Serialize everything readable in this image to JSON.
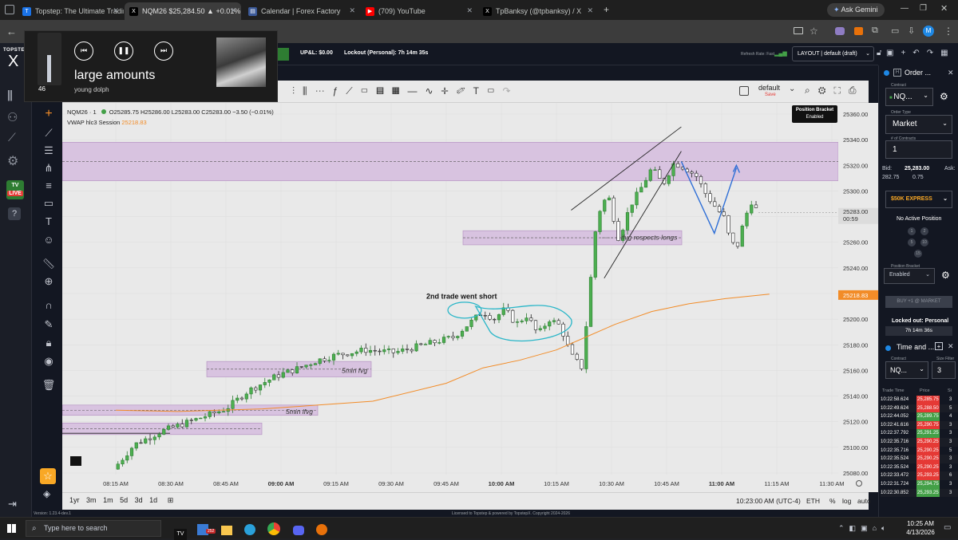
{
  "browser": {
    "tabs": [
      {
        "label": "Topstep: The Ultimate Trading E",
        "color": "#1a73e8",
        "glyph": "T"
      },
      {
        "label": "NQM26 $25,284.50 ▲ +0.01%",
        "color": "#000000",
        "glyph": "X"
      },
      {
        "label": "Calendar | Forex Factory",
        "color": "#3b5998",
        "glyph": "▤"
      },
      {
        "label": "(709) YouTube",
        "color": "#ff0000",
        "glyph": "▶"
      },
      {
        "label": "TpBanksy (@tpbanksy) / X",
        "color": "#000000",
        "glyph": "X"
      }
    ],
    "ask_gemini": "Ask Gemini",
    "profile_initial": "M"
  },
  "media": {
    "title": "large amounts",
    "artist": "young dolph"
  },
  "topbar": {
    "logo": "TOPSTEP",
    "logo_mark": "X",
    "count": "46",
    "upl": "UP&L: $0.00",
    "lockout": "Lockout (Personal): 7h 14m 35s",
    "refresh": "Refresh Rate: Fast",
    "layout": "LAYOUT | default (draft)"
  },
  "chart_toolbar": {
    "layout_name": "default",
    "save": "Save",
    "position_bracket": "Position Bracket",
    "position_bracket_status": "Enabled"
  },
  "legend": {
    "symbol": "NQM26 · 1",
    "ohlc": "O25285.75  H25286.00  L25283.00  C25283.00  −3.50 (−0.01%)",
    "vwap_label": "VWAP hlc3 Session",
    "vwap_value": "25218.83"
  },
  "price_axis": {
    "ticks": [
      "25360.00",
      "25340.00",
      "25320.00",
      "25300.00",
      "25280.00",
      "25260.00",
      "25240.00",
      "25220.00",
      "25200.00",
      "25180.00",
      "25160.00",
      "25140.00",
      "25120.00",
      "25100.00",
      "25080.00"
    ],
    "last_price": "25283.00",
    "countdown": "00:59",
    "vwap_tag": "25218.83"
  },
  "time_axis": {
    "ticks": [
      "08:15 AM",
      "08:30 AM",
      "08:45 AM",
      "09:00 AM",
      "09:15 AM",
      "09:30 AM",
      "09:45 AM",
      "10:00 AM",
      "10:15 AM",
      "10:30 AM",
      "10:45 AM",
      "11:00 AM",
      "11:15 AM",
      "11:30 AM"
    ]
  },
  "annotations": {
    "ifvg": "ifvg respects longs",
    "short": "2nd trade went short",
    "fvg5": "5min fvg",
    "ifvg5": "5min ifvg"
  },
  "bottom_bar": {
    "ranges": [
      "1yr",
      "3m",
      "1m",
      "5d",
      "3d",
      "1d"
    ],
    "clock": "10:23:00 AM (UTC-4)",
    "session": "ETH",
    "pct": "%",
    "log": "log",
    "auto": "auto"
  },
  "footer": {
    "version": "Version: 1.23.4-dev.1",
    "license": "Licensed to Topstep & powered by TopstepX. Copyright 2024-2026"
  },
  "order_panel": {
    "title": "Order ...",
    "contract_label": "Contract",
    "contract": "NQ...",
    "order_type_label": "Order Type",
    "order_type": "Market",
    "contracts_label": "# of Contracts",
    "contracts": "1",
    "bid_label": "Bid:",
    "bid": "282.75",
    "mid": "25,283.00",
    "spread": "0.75",
    "ask_label": "Ask:",
    "account": "$50K EXPRESS",
    "no_position": "No Active Position",
    "qty_buttons": [
      "1",
      "2",
      "5",
      "10",
      "15"
    ],
    "pb_label": "Position Bracket",
    "pb_value": "Enabled",
    "buy_button": "BUY +1 @ MARKET",
    "locked": "Locked out: Personal",
    "locked_time": "7h 14m 36s"
  },
  "time_sales": {
    "title": "Time and ...",
    "contract_label": "Contract",
    "contract": "NQ...",
    "size_label": "Size Filter",
    "size": "3",
    "headers": [
      "Trade Time",
      "Price",
      "Si"
    ],
    "rows": [
      {
        "time": "10:22:58.624",
        "price": "25,285.75",
        "size": "3",
        "side": "sell"
      },
      {
        "time": "10:22:49.624",
        "price": "25,288.50",
        "size": "5",
        "side": "sell"
      },
      {
        "time": "10:22:44.052",
        "price": "25,289.75",
        "size": "4",
        "side": "buy"
      },
      {
        "time": "10:22:41.616",
        "price": "25,290.75",
        "size": "3",
        "side": "sell"
      },
      {
        "time": "10:22:37.792",
        "price": "25,291.25",
        "size": "3",
        "side": "buy"
      },
      {
        "time": "10:22:35.716",
        "price": "25,290.25",
        "size": "3",
        "side": "sell"
      },
      {
        "time": "10:22:35.716",
        "price": "25,290.25",
        "size": "5",
        "side": "sell"
      },
      {
        "time": "10:22:35.524",
        "price": "25,290.25",
        "size": "3",
        "side": "sell"
      },
      {
        "time": "10:22:35.524",
        "price": "25,290.25",
        "size": "3",
        "side": "sell"
      },
      {
        "time": "10:22:33.472",
        "price": "25,293.25",
        "size": "6",
        "side": "sell"
      },
      {
        "time": "10:22:31.724",
        "price": "25,294.75",
        "size": "3",
        "side": "buy"
      },
      {
        "time": "10:22:30.852",
        "price": "25,293.25",
        "size": "3",
        "side": "buy"
      }
    ]
  },
  "taskbar": {
    "search_placeholder": "Type here to search",
    "time": "10:25 AM",
    "date": "4/13/2026",
    "badge": "252"
  },
  "colors": {
    "candle_up": "#2e7d32",
    "candle_down": "#222222",
    "zone_fill": "#d8c3e0",
    "vwap": "#f28c28",
    "sell": "#e53935",
    "buy": "#43a047"
  }
}
